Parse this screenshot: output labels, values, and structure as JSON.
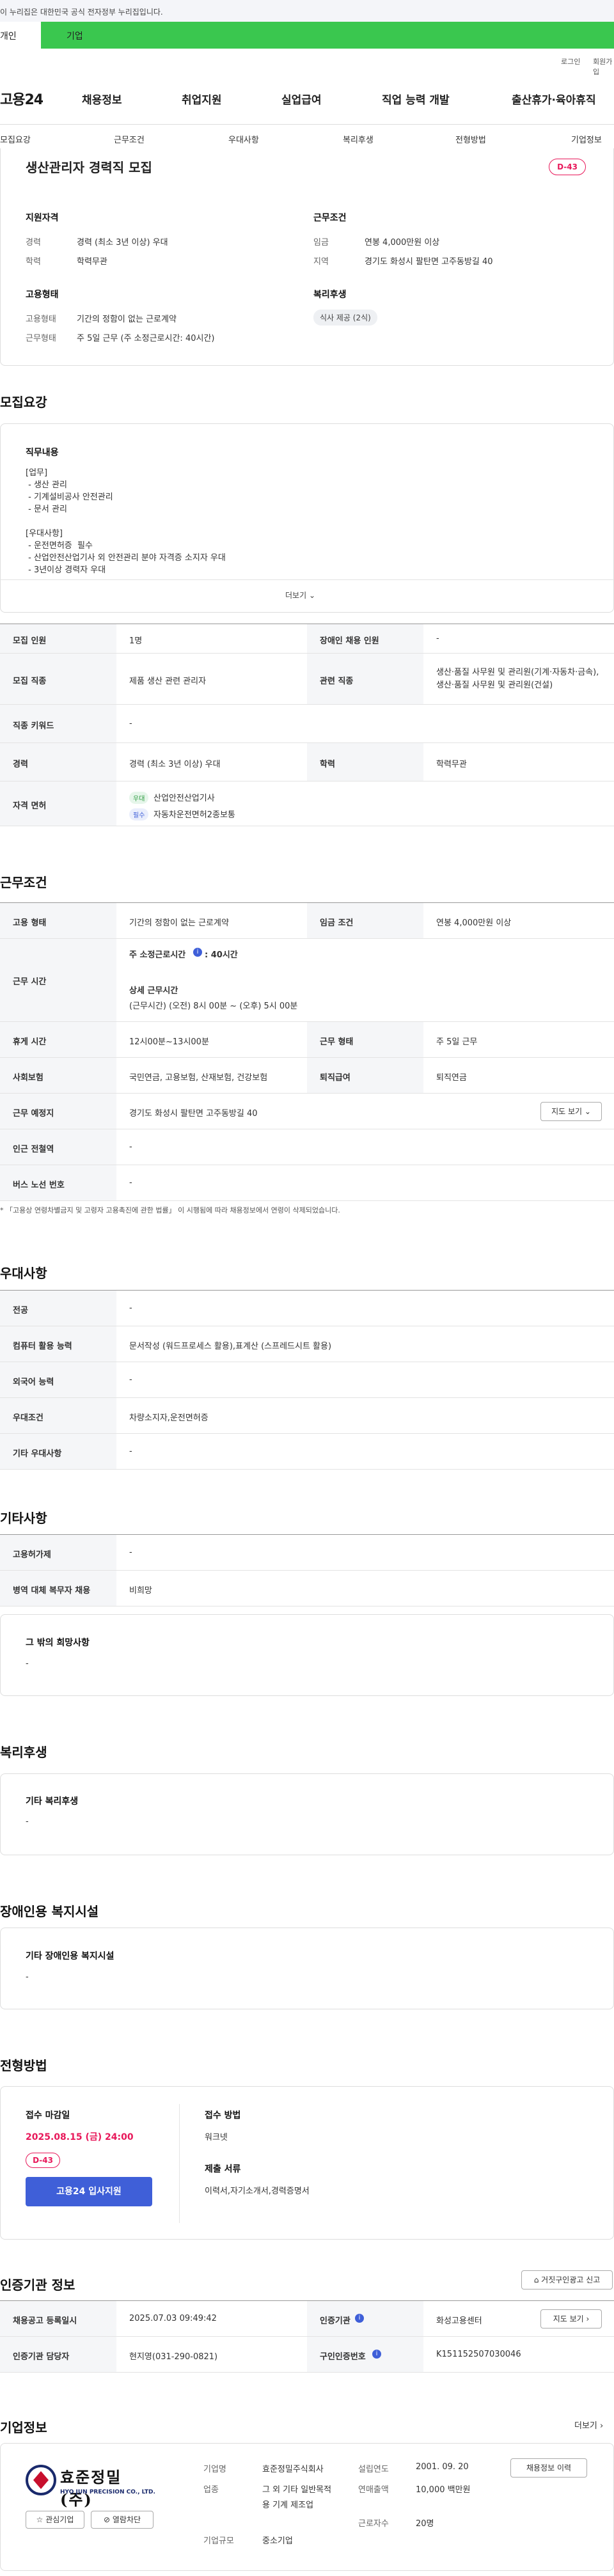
{
  "gov_banner": "이 누리집은 대한민국 공식 전자정부 누리집입니다.",
  "top_tabs": {
    "individual": "개인",
    "corporate": "기업"
  },
  "util": {
    "login": "로그인",
    "signup": "회원가입"
  },
  "logo": "고용24",
  "gnb": [
    "채용정보",
    "취업지원",
    "실업급여",
    "직업 능력 개발",
    "출산휴가·육아휴직"
  ],
  "subnav": [
    "모집요강",
    "근무조건",
    "우대사항",
    "복리후생",
    "전형방법",
    "기업정보"
  ],
  "summary": {
    "title": "생산관리자 경력직 모집",
    "dday": "D-43",
    "qual_title": "지원자격",
    "qual": [
      {
        "k": "경력",
        "v": "경력 (최소 3년 이상) 우대"
      },
      {
        "k": "학력",
        "v": "학력무관"
      }
    ],
    "cond_title": "근무조건",
    "cond": [
      {
        "k": "임금",
        "v": "연봉 4,000만원 이상"
      },
      {
        "k": "지역",
        "v": "경기도 화성시 팔탄면 고주동방길 40"
      }
    ],
    "emp_title": "고용형태",
    "emp": [
      {
        "k": "고용형태",
        "v": "기간의 정함이 없는 근로계약"
      },
      {
        "k": "근무형태",
        "v": "주 5일 근무 (주 소정근로시간: 40시간)"
      }
    ],
    "welfare_title": "복리후생",
    "welfare_chip": "식사 제공 (2식)"
  },
  "recruit": {
    "title": "모집요강",
    "duty_title": "직무내용",
    "duty_text": "[업무]\n - 생산 관리\n - 기계설비공사 안전관리\n - 문서 관리\n\n[우대사항]\n - 운전면허증  필수\n - 산업안전산업기사 외 안전관리 분야 자격증 소지자 우대\n - 3년이상 경력자 우대",
    "more": "더보기",
    "rows": [
      {
        "k1": "모집 인원",
        "v1": "1명",
        "k2": "장애인 채용 인원",
        "v2": "-"
      },
      {
        "k1": "모집 직종",
        "v1": "제품 생산 관련 관리자",
        "k2": "관련 직종",
        "v2": "생산·품질 사무원 및 관리원(기계·자동차·금속), 생산·품질 사무원 및 관리원(건설)"
      },
      {
        "k1": "직종 키워드",
        "v1": "-"
      },
      {
        "k1": "경력",
        "v1": "경력 (최소 3년 이상) 우대",
        "k2": "학력",
        "v2": "학력무관"
      }
    ],
    "license_label": "자격 면허",
    "licenses": [
      {
        "tag": "우대",
        "name": "산업안전산업기사"
      },
      {
        "tag": "필수",
        "name": "자동차운전면허2종보통"
      }
    ]
  },
  "work": {
    "title": "근무조건",
    "r1": {
      "k1": "고용 형태",
      "v1": "기간의 정함이 없는 근로계약",
      "k2": "임금 조건",
      "v2": "연봉 4,000만원 이상"
    },
    "hours": {
      "k": "근무 시간",
      "weekly_label": "주 소정근로시간",
      "weekly_val": ": 40시간",
      "detail_label": "상세 근무시간",
      "detail_val": "(근무시간) (오전) 8시 00분 ~ (오후) 5시 00분"
    },
    "r3": {
      "k1": "휴게 시간",
      "v1": "12시00분~13시00분",
      "k2": "근무 형태",
      "v2": "주 5일 근무"
    },
    "r4": {
      "k1": "사회보험",
      "v1": "국민연금, 고용보험, 산재보험, 건강보험",
      "k2": "퇴직급여",
      "v2": "퇴직연금"
    },
    "r5": {
      "k1": "근무 예정지",
      "v1": "경기도 화성시 팔탄면 고주동방길 40",
      "btn": "지도 보기"
    },
    "r6": {
      "k1": "인근 전철역",
      "v1": "-"
    },
    "r7": {
      "k1": "버스 노선 번호",
      "v1": "-"
    },
    "note": "* 「고용상 연령차별금지 및 고령자 고용촉진에 관한 법률」 이 시행됨에 따라 채용정보에서 연령이 삭제되었습니다."
  },
  "pref": {
    "title": "우대사항",
    "rows": [
      {
        "k": "전공",
        "v": "-"
      },
      {
        "k": "컴퓨터 활용 능력",
        "v": "문서작성 (워드프로세스 활용),표계산 (스프레드시트 활용)"
      },
      {
        "k": "외국어 능력",
        "v": "-"
      },
      {
        "k": "우대조건",
        "v": "차량소지자,운전면허증"
      },
      {
        "k": "기타 우대사항",
        "v": "-"
      }
    ]
  },
  "etc": {
    "title": "기타사항",
    "rows": [
      {
        "k": "고용허가제",
        "v": "-"
      },
      {
        "k": "병역 대체 복무자 채용",
        "v": "비희망"
      }
    ],
    "box_title": "그 밖의 희망사항",
    "box_val": "-"
  },
  "welfare": {
    "title": "복리후생",
    "box_title": "기타 복리후생",
    "box_val": "-"
  },
  "disabled": {
    "title": "장애인용 복지시설",
    "box_title": "기타 장애인용 복지시설",
    "box_val": "-"
  },
  "screening": {
    "title": "전형방법",
    "deadline_label": "접수 마감일",
    "deadline": "2025.08.15 (금) 24:00",
    "dday": "D-43",
    "apply_btn": "고용24 입사지원",
    "method_label": "접수 방법",
    "method": "워크넷",
    "docs_label": "제출 서류",
    "docs": "이력서,자기소개서,경력증명서"
  },
  "cert": {
    "title": "인증기관 정보",
    "report_btn": "거짓구인광고 신고",
    "rows": [
      {
        "k1": "채용공고 등록일시",
        "v1": "2025.07.03 09:49:42",
        "k2": "인증기관",
        "v2": "화성고용센터",
        "btn": "지도 보기"
      },
      {
        "k1": "인증기관 담당자",
        "v1": "현지영(031-290-0821)",
        "k2": "구인인증번호",
        "v2": "K151152507030046"
      }
    ]
  },
  "company": {
    "title": "기업정보",
    "more": "더보기",
    "logo_ko": "효준정밀(주)",
    "logo_en": "HYO JUN PRECISION CO., LTD.",
    "fav_btn": "관심기업",
    "block_btn": "열람차단",
    "info": [
      {
        "k": "기업명",
        "v": "효준정밀주식회사"
      },
      {
        "k": "업종",
        "v": "그 외 기타 일반목적용 기계 제조업"
      },
      {
        "k": "기업규모",
        "v": "중소기업"
      }
    ],
    "info2": [
      {
        "k": "설립연도",
        "v": "2001. 09. 20"
      },
      {
        "k": "연매출액",
        "v": "10,000 백만원"
      },
      {
        "k": "근로자수",
        "v": "20명"
      }
    ],
    "hire_btn": "채용정보 이력"
  },
  "colors": {
    "green": "#3ac74f",
    "pink": "#e8185a",
    "blue": "#3f5fd8"
  }
}
